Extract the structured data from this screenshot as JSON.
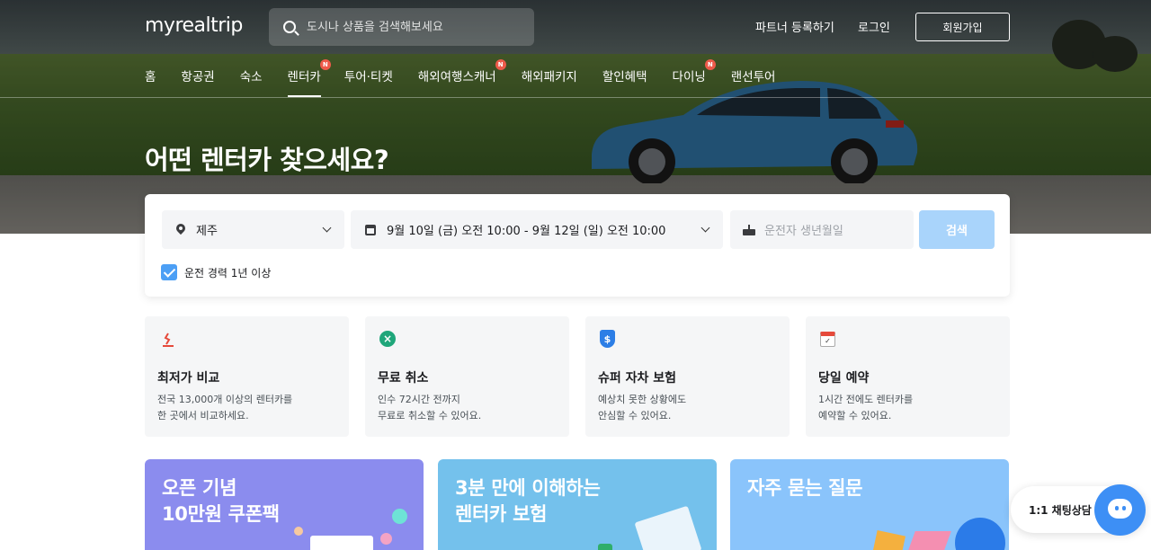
{
  "header": {
    "logo": "myrealtrip",
    "search_placeholder": "도시나 상품을 검색해보세요",
    "partner_link": "파트너 등록하기",
    "login_link": "로그인",
    "signup_button": "회원가입"
  },
  "nav": {
    "items": [
      {
        "label": "홈",
        "badge": ""
      },
      {
        "label": "항공권",
        "badge": ""
      },
      {
        "label": "숙소",
        "badge": ""
      },
      {
        "label": "렌터카",
        "badge": "N"
      },
      {
        "label": "투어·티켓",
        "badge": ""
      },
      {
        "label": "해외여행스캐너",
        "badge": "N"
      },
      {
        "label": "해외패키지",
        "badge": ""
      },
      {
        "label": "할인혜택",
        "badge": ""
      },
      {
        "label": "다이닝",
        "badge": "N"
      },
      {
        "label": "랜선투어",
        "badge": ""
      }
    ],
    "active": "렌터카"
  },
  "hero": {
    "title": "어떤 렌터카 찾으세요?"
  },
  "search_form": {
    "location": "제주",
    "date_range": "9월 10일 (금) 오전 10:00 - 9월 12일 (일) 오전 10:00",
    "birth_placeholder": "운전자 생년월일",
    "search_button": "검색",
    "experience_checkbox": "운전 경력 1년 이상",
    "experience_checked": true
  },
  "features": [
    {
      "icon": "price-tag-icon",
      "title": "최저가 비교",
      "desc": "전국 13,000개 이상의 렌터카를\n한 곳에서 비교하세요."
    },
    {
      "icon": "cancel-icon",
      "title": "무료 취소",
      "desc": "인수 72시간 전까지\n무료로 취소할 수 있어요."
    },
    {
      "icon": "shield-icon",
      "title": "슈퍼 자차 보험",
      "desc": "예상치 못한 상황에도\n안심할 수 있어요."
    },
    {
      "icon": "calendar-icon",
      "title": "당일 예약",
      "desc": "1시간 전에도 렌터카를\n예약할 수 있어요."
    }
  ],
  "banners": [
    {
      "title": "오픈 기념\n10만원 쿠폰팩",
      "color": "#8b8cee"
    },
    {
      "title": "3분 만에 이해하는\n렌터카 보험",
      "color": "#74c1ec"
    },
    {
      "title": "자주 묻는 질문",
      "color": "#8ac4fb"
    }
  ],
  "chat": {
    "label": "1:1 채팅상담"
  },
  "colors": {
    "accent": "#3d8ff5",
    "search_button": "#a9d4fb",
    "badge": "#ee5a4a"
  }
}
